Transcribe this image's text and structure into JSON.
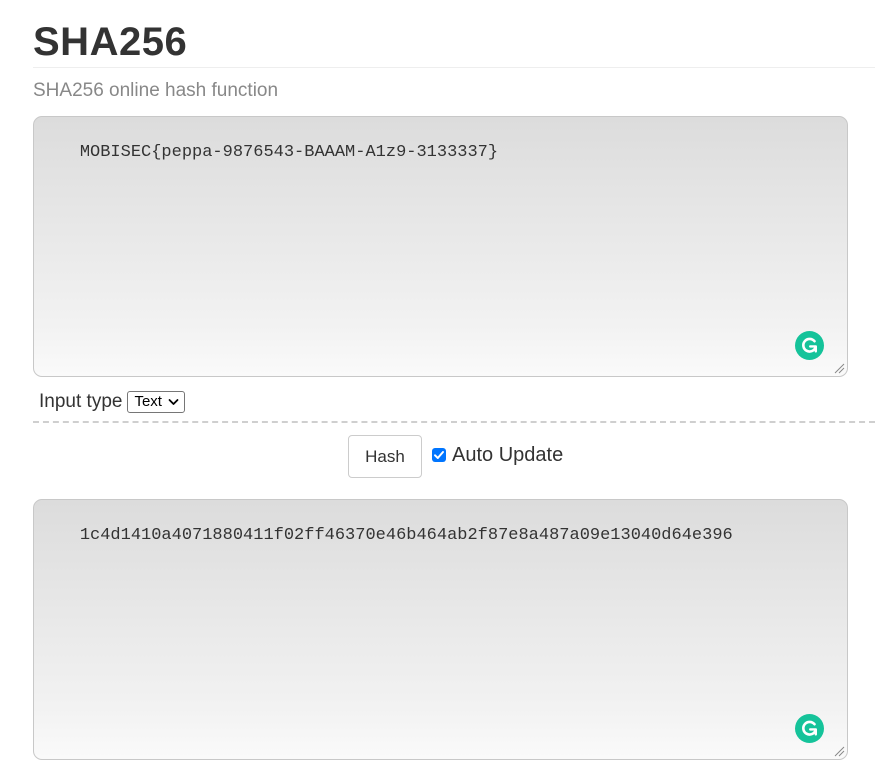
{
  "header": {
    "title": "SHA256",
    "subtitle": "SHA256 online hash function"
  },
  "input": {
    "value": "MOBISEC{peppa-9876543-BAAAM-A1z9-3133337}"
  },
  "input_type": {
    "label": "Input type",
    "selected": "Text"
  },
  "controls": {
    "hash_label": "Hash",
    "auto_update_label": "Auto Update",
    "auto_update_checked": true
  },
  "output": {
    "value": "1c4d1410a4071880411f02ff46370e46b464ab2f87e8a487a09e13040d64e396"
  },
  "colors": {
    "grammarly": "#15c39a",
    "checkbox": "#0075ff"
  },
  "icons": {
    "grammar": "grammarly-icon",
    "chevron": "chevron-down-icon",
    "check": "check-icon",
    "resize": "resize-handle-icon"
  }
}
